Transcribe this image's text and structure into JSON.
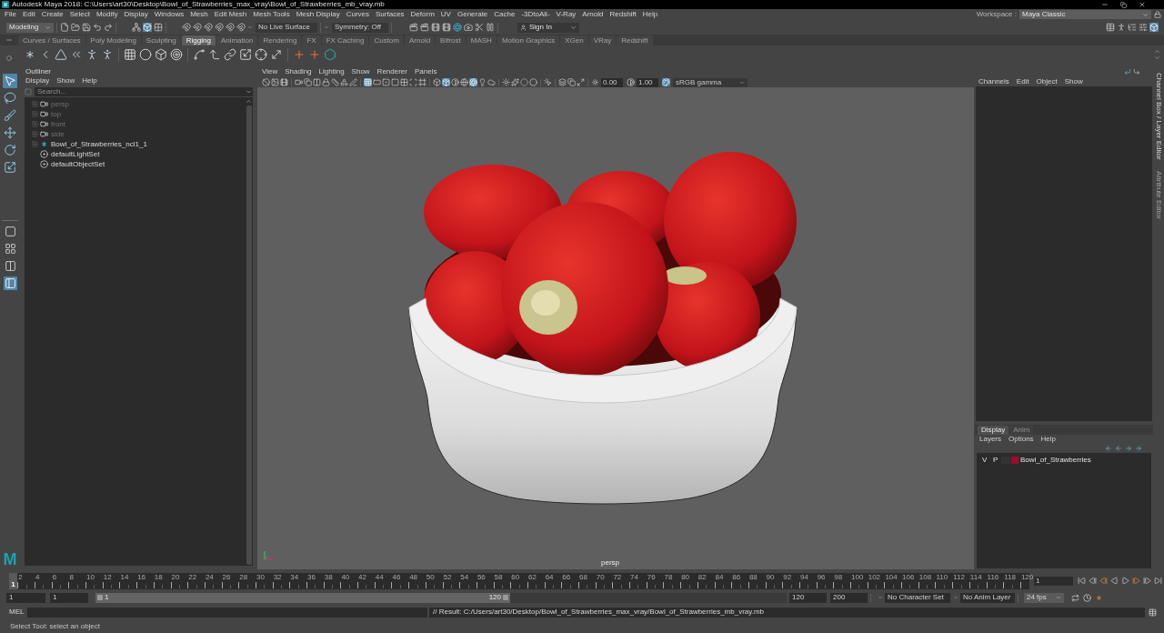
{
  "window": {
    "title": "Autodesk Maya 2018: C:\\Users\\art30\\Desktop\\Bowl_of_Strawberries_max_vray\\Bowl_of_Strawberries_mb_vray.mb"
  },
  "menu_bar": {
    "items": [
      "File",
      "Edit",
      "Create",
      "Select",
      "Modify",
      "Display",
      "Windows",
      "Mesh",
      "Edit Mesh",
      "Mesh Tools",
      "Mesh Display",
      "Curves",
      "Surfaces",
      "Deform",
      "UV",
      "Generate",
      "Cache",
      "-3DtoAll-",
      "V-Ray",
      "Arnold",
      "Redshift",
      "Help"
    ],
    "workspace_label": "Workspace :",
    "workspace": "Maya Classic"
  },
  "status_line": {
    "menu_set": "Modeling",
    "selection_modes": [
      {
        "selected": false
      },
      {
        "selected": true
      },
      {
        "selected": false
      }
    ],
    "live_surface": "No Live Surface",
    "symmetry": "Symmetry: Off",
    "sign_in": "Sign In",
    "panel_toggles": [
      {
        "selected": false
      },
      {
        "selected": false
      },
      {
        "selected": false
      },
      {
        "selected": false
      },
      {
        "selected": true
      }
    ]
  },
  "shelf": {
    "tabs": [
      {
        "label": "Curves / Surfaces",
        "selected": false
      },
      {
        "label": "Poly Modeling",
        "selected": false
      },
      {
        "label": "Sculpting",
        "selected": false
      },
      {
        "label": "Rigging",
        "selected": true
      },
      {
        "label": "Animation",
        "selected": false
      },
      {
        "label": "Rendering",
        "selected": false
      },
      {
        "label": "FX",
        "selected": false
      },
      {
        "label": "FX Caching",
        "selected": false
      },
      {
        "label": "Custom",
        "selected": false
      },
      {
        "label": "Arnold",
        "selected": false
      },
      {
        "label": "Bifrost",
        "selected": false
      },
      {
        "label": "MASH",
        "selected": false
      },
      {
        "label": "Motion Graphics",
        "selected": false
      },
      {
        "label": "XGen",
        "selected": false
      },
      {
        "label": "VRay",
        "selected": false
      },
      {
        "label": "Redshift",
        "selected": false
      }
    ]
  },
  "toolbox": {
    "tools": [
      {
        "selected": true
      },
      {
        "selected": false
      },
      {
        "selected": false
      },
      {
        "selected": false
      },
      {
        "selected": false
      },
      {
        "selected": false
      }
    ],
    "layouts": [
      {
        "selected": false
      },
      {
        "selected": false
      },
      {
        "selected": false
      },
      {
        "selected": true
      }
    ],
    "logo": "M"
  },
  "outliner": {
    "title": "Outliner",
    "menu": [
      "Display",
      "Show",
      "Help"
    ],
    "search": {
      "placeholder": "Search..."
    },
    "items": [
      {
        "label": "persp",
        "kind": "camera",
        "hidden": true,
        "expandable": true
      },
      {
        "label": "top",
        "kind": "camera",
        "hidden": true,
        "expandable": true
      },
      {
        "label": "front",
        "kind": "camera",
        "hidden": true,
        "expandable": true
      },
      {
        "label": "side",
        "kind": "camera",
        "hidden": true,
        "expandable": true
      },
      {
        "label": "Bowl_of_Strawberries_ncl1_1",
        "kind": "node",
        "hidden": false,
        "expandable": true
      },
      {
        "label": "defaultLightSet",
        "kind": "set",
        "hidden": false,
        "expandable": false
      },
      {
        "label": "defaultObjectSet",
        "kind": "set",
        "hidden": false,
        "expandable": false
      }
    ]
  },
  "viewport": {
    "menu": [
      "View",
      "Shading",
      "Lighting",
      "Show",
      "Renderer",
      "Panels"
    ],
    "toggle_groups": [
      [
        {
          "selected": false
        },
        {
          "selected": false
        },
        {
          "selected": false
        }
      ],
      [
        {
          "selected": false
        },
        {
          "selected": false
        },
        {
          "selected": false
        },
        {
          "selected": false
        },
        {
          "selected": false
        },
        {
          "selected": false
        },
        {
          "selected": false
        }
      ],
      [
        {
          "selected": true
        },
        {
          "selected": false
        },
        {
          "selected": false
        },
        {
          "selected": false
        },
        {
          "selected": false
        },
        {
          "selected": false
        },
        {
          "selected": false
        }
      ],
      [
        {
          "selected": false
        },
        {
          "selected": true
        },
        {
          "selected": false
        },
        {
          "selected": false
        },
        {
          "selected": true
        },
        {
          "selected": false
        },
        {
          "selected": false
        }
      ],
      [
        {
          "selected": false
        },
        {
          "selected": false
        },
        {
          "selected": false
        },
        {
          "selected": false
        }
      ],
      [
        {
          "selected": false
        }
      ],
      [
        {
          "selected": false
        },
        {
          "selected": false
        },
        {
          "selected": false
        }
      ]
    ],
    "color_toggles": [
      {
        "selected": false
      },
      {
        "selected": false
      },
      {
        "selected": true
      }
    ],
    "exposure": "0.00",
    "gamma": "1.00",
    "color_space": "sRGB gamma",
    "camera": "persp"
  },
  "channel_box": {
    "menu": [
      "Channels",
      "Edit",
      "Object",
      "Show"
    ],
    "side_tabs": [
      {
        "label": "Channel Box / Layer Editor",
        "selected": true
      },
      {
        "label": "Attribute Editor",
        "selected": false
      }
    ]
  },
  "layer_editor": {
    "tabs": [
      {
        "label": "Display",
        "selected": true
      },
      {
        "label": "Anim",
        "selected": false
      }
    ],
    "menu": [
      "Layers",
      "Options",
      "Help"
    ],
    "layers": [
      {
        "visible": "V",
        "playback": "P",
        "color": "#a00a2c",
        "name": "Bowl_of_Strawberries"
      }
    ]
  },
  "time_slider": {
    "current_marker": "1",
    "level": 0,
    "frame_labels": [
      "2",
      "4",
      "6",
      "8",
      "10",
      "12",
      "14",
      "16",
      "18",
      "20",
      "22",
      "24",
      "26",
      "28",
      "30",
      "32",
      "34",
      "36",
      "38",
      "40",
      "42",
      "44",
      "46",
      "48",
      "50",
      "52",
      "54",
      "56",
      "58",
      "60",
      "62",
      "64",
      "66",
      "68",
      "70",
      "72",
      "74",
      "76",
      "78",
      "80",
      "82",
      "84",
      "86",
      "88",
      "90",
      "92",
      "94",
      "96",
      "98",
      "100",
      "102",
      "104",
      "106",
      "108",
      "110",
      "112",
      "114",
      "116",
      "118",
      "120"
    ],
    "current_frame": "1"
  },
  "range_slider": {
    "anim_start": "1",
    "playback_start": "1",
    "range_start": "1",
    "range_end": "120",
    "level": 0.6,
    "playback_end": "120",
    "anim_end": "200",
    "character_set": "No Character Set",
    "anim_layer": "No Anim Layer",
    "fps": "24 fps"
  },
  "command_line": {
    "language": "MEL",
    "result": "// Result: C:/Users/art30/Desktop/Bowl_of_Strawberries_max_vray/Bowl_of_Strawberries_mb_vray.mb"
  },
  "help_line": "Select Tool: select an object"
}
